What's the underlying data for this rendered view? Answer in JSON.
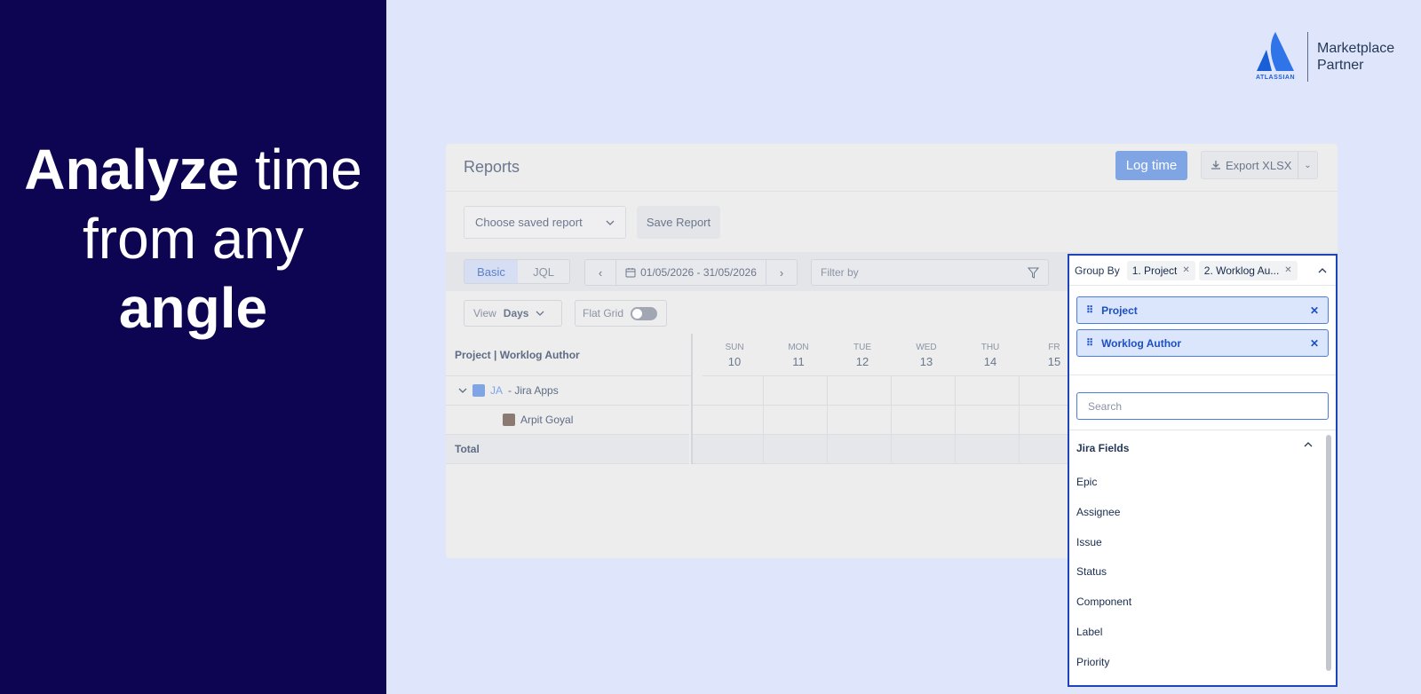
{
  "headline": {
    "word1": "Analyze",
    "word2": "time",
    "line2": "from any",
    "line3": "angle"
  },
  "partner": {
    "logo_word": "ATLASSIAN",
    "line1": "Marketplace",
    "line2": "Partner",
    "brand_color": "#1b5fd6"
  },
  "app": {
    "title": "Reports",
    "log_time": "Log time",
    "export": "Export XLSX",
    "saved_report_placeholder": "Choose saved report",
    "save_report": "Save Report",
    "mode_basic": "Basic",
    "mode_jql": "JQL",
    "date_range": "01/05/2026 - 31/05/2026",
    "filter_placeholder": "Filter by",
    "view_label": "View",
    "view_value": "Days",
    "flat_grid": "Flat Grid"
  },
  "grid": {
    "header": "Project | Worklog Author",
    "days": [
      {
        "name": "SUN",
        "num": "10"
      },
      {
        "name": "MON",
        "num": "11"
      },
      {
        "name": "TUE",
        "num": "12"
      },
      {
        "name": "WED",
        "num": "13"
      },
      {
        "name": "THU",
        "num": "14"
      },
      {
        "name": "FR",
        "num": "15"
      }
    ],
    "project_key": "JA",
    "project_name": "- Jira Apps",
    "author": "Arpit Goyal",
    "total": "Total"
  },
  "group_by": {
    "label": "Group By",
    "chips": [
      "1. Project",
      "2. Worklog Au..."
    ],
    "selected": [
      "Project",
      "Worklog Author"
    ],
    "search_placeholder": "Search",
    "section": "Jira Fields",
    "fields": [
      "Epic",
      "Assignee",
      "Issue",
      "Status",
      "Component",
      "Label",
      "Priority"
    ]
  }
}
